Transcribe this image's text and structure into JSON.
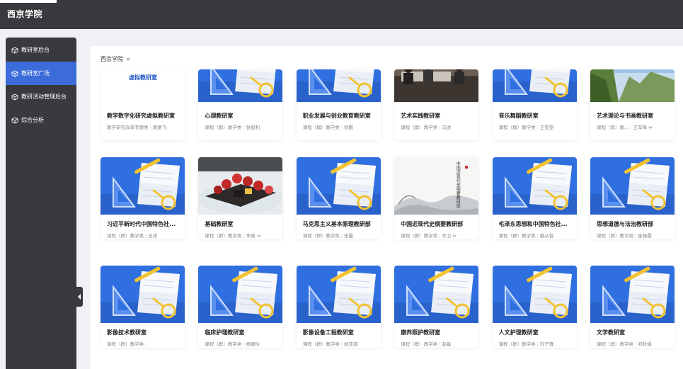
{
  "header": {
    "title": "西京学院"
  },
  "sidebar": {
    "items": [
      {
        "label": "教研室后台",
        "active": false
      },
      {
        "label": "教研室广场",
        "active": true
      },
      {
        "label": "教研活动管理后台",
        "active": false
      },
      {
        "label": "综合分析",
        "active": false
      }
    ]
  },
  "breadcrumb": {
    "label": "西京学院"
  },
  "colors": {
    "accent": "#3b6cd9",
    "dark": "#3a3a3e",
    "thumb_blue": "#2f6fe0"
  },
  "cards": [
    {
      "title": "教学数字化研究虚拟教研室",
      "type": "教学研究改革专题类",
      "owner": "黄丽飞",
      "thumb": "logo-banner",
      "banner_text": "虚拟教研室",
      "chevron": false
    },
    {
      "title": "心理教研室",
      "type": "课程（群）教学类",
      "owner": "张俊利",
      "thumb": "stationery",
      "chevron": false
    },
    {
      "title": "职业发展与创业教育教研室",
      "type": "课程（群）教学类",
      "owner": "徐鹏",
      "thumb": "stationery",
      "chevron": false
    },
    {
      "title": "艺术实践教研室",
      "type": "课程（群）教学类",
      "owner": "马进",
      "thumb": "meeting-photo",
      "chevron": false
    },
    {
      "title": "音乐舞蹈教研室",
      "type": "课程（群）教学类",
      "owner": "王雯雯",
      "thumb": "stationery",
      "chevron": false
    },
    {
      "title": "艺术理论与书画教研室",
      "type": "课程（群）教...",
      "owner": "王军梅",
      "thumb": "landscape-photo",
      "chevron": true
    },
    {
      "title": "习近平新时代中国特色社...",
      "type": "课程（群）教学类",
      "owner": "王琪",
      "thumb": "stationery",
      "chevron": false
    },
    {
      "title": "基础教研室",
      "type": "课程（群）教学类",
      "owner": "李勇",
      "thumb": "boat-photo",
      "chevron": true
    },
    {
      "title": "马克思主义基本原理教研部",
      "type": "课程（群）教学类",
      "owner": "张露",
      "thumb": "stationery",
      "chevron": false
    },
    {
      "title": "中国近现代史纲要教研部",
      "type": "课程（群）教学类",
      "owner": "李卫",
      "thumb": "ink-painting",
      "ink_text": "中国近现代史纲要教研部",
      "chevron": true
    },
    {
      "title": "毛泽东思想和中国特色社...",
      "type": "课程（群）教学类",
      "owner": "戴从容",
      "thumb": "stationery",
      "chevron": false
    },
    {
      "title": "思想道德与法治教研部",
      "type": "课程（群）教学类",
      "owner": "崔杨霞",
      "thumb": "stationery",
      "chevron": false
    },
    {
      "title": "影像技术教研室",
      "type": "课程（群）教学类",
      "owner": "",
      "thumb": "stationery",
      "chevron": false
    },
    {
      "title": "临床护理教研室",
      "type": "课程（群）教学类",
      "owner": "杨婕玲",
      "thumb": "stationery",
      "chevron": false
    },
    {
      "title": "影像设备工程教研室",
      "type": "课程（群）教学类",
      "owner": "胡亚南",
      "thumb": "stationery",
      "chevron": false
    },
    {
      "title": "康养照护教研室",
      "type": "课程（群）教学类",
      "owner": "赵磊",
      "thumb": "stationery",
      "chevron": false
    },
    {
      "title": "人文护理教研室",
      "type": "课程（群）教学类",
      "owner": "刘子瑾",
      "thumb": "stationery",
      "chevron": false
    },
    {
      "title": "文学教研室",
      "type": "课程（群）教学类",
      "owner": "祁秋娟",
      "thumb": "stationery",
      "chevron": false
    }
  ]
}
